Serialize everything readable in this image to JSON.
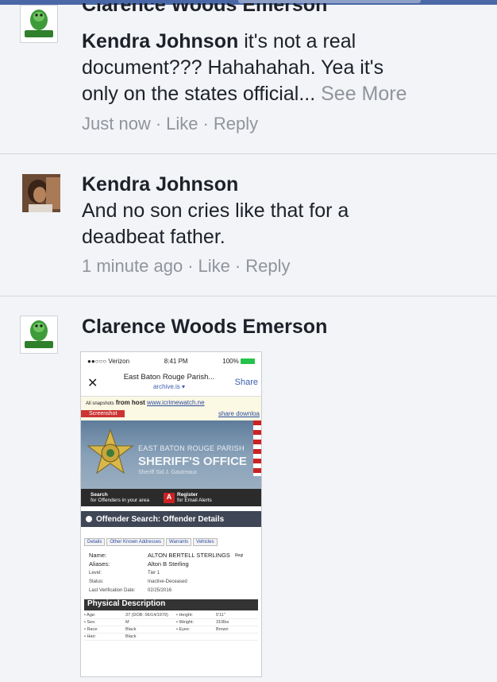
{
  "comments": [
    {
      "author": "Clarence Woods Emerson",
      "mention": "Kendra Johnson",
      "text_line1": " it's not a real",
      "text_line2": "document??? Hahahahah. Yea it's",
      "text_line3": "only on the states official...",
      "see_more": "See More",
      "time": "Just now",
      "like": "Like",
      "reply": "Reply"
    },
    {
      "author": "Kendra Johnson",
      "text_line1": "And no son cries like that for a",
      "text_line2": "deadbeat father.",
      "time": "1 minute ago",
      "like": "Like",
      "reply": "Reply"
    },
    {
      "author": "Clarence Woods Emerson"
    }
  ],
  "avatar_text": "Turtle boy",
  "attachment": {
    "status": {
      "carrier": "●●○○○ Verizon",
      "time": "8:41 PM",
      "battery": "100%"
    },
    "nav": {
      "close": "✕",
      "title": "East Baton Rouge Parish...",
      "subtitle": "archive.is ▾",
      "share": "Share"
    },
    "snapshot": {
      "prefix": "All snapshots",
      "from_host": "from host",
      "host": "www.icrimewatch.ne",
      "tag": "Screenshot",
      "share": "share",
      "download": "downloa"
    },
    "banner": {
      "line1": "EAST BATON ROUGE PARISH",
      "line2": "SHERIFF'S OFFICE",
      "line3": "Sheriff Sid J. Gautreaux",
      "search_title": "Search",
      "search_sub": "for Offenders in your area",
      "register_title": "Register",
      "register_sub": "for Email Alerts"
    },
    "offender_heading": "Offender Search: Offender Details",
    "tabs": [
      "Details",
      "Other Known Addresses",
      "Warrants",
      "Vehicles"
    ],
    "details": [
      {
        "k": "Name:",
        "v": "ALTON BERTELL STERLINGS"
      },
      {
        "k": "Aliases:",
        "v": "Alton B Sterling"
      },
      {
        "k": "Level:",
        "v": "Tier 1"
      },
      {
        "k": "Status:",
        "v": "Inactive-Deceased"
      },
      {
        "k": "Last Verification Date:",
        "v": "02/25/2016"
      }
    ],
    "reg_cut": "Regi",
    "physical_heading": "Physical Description",
    "physical": [
      [
        "• Age:",
        "37 (DOB: 06/14/1979)",
        "• Height:",
        "5'11\""
      ],
      [
        "• Sex:",
        "M",
        "• Weight:",
        "310lbs"
      ],
      [
        "• Race:",
        "Black",
        "• Eyes:",
        "Brown"
      ],
      [
        "• Hair:",
        "Black",
        "",
        ""
      ]
    ]
  }
}
